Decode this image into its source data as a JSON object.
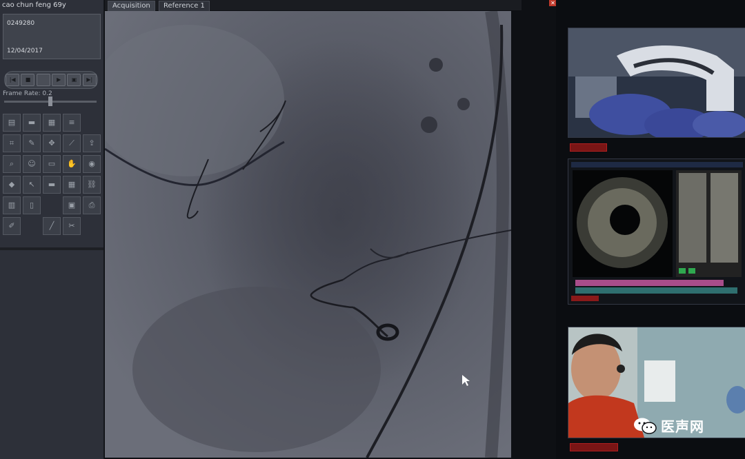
{
  "patient": {
    "name": "cao chun feng 69y",
    "id": "0249280",
    "date": "12/04/2017"
  },
  "playback": {
    "frame_rate_label": "Frame Rate: 0.2",
    "controls": [
      "first-frame-icon",
      "stop-icon",
      "pause-icon",
      "play-icon",
      "step-icon",
      "last-frame-icon"
    ]
  },
  "tabs": [
    {
      "label": "Acquisition",
      "active": true
    },
    {
      "label": "Reference 1",
      "active": false
    }
  ],
  "tools": [
    "archive-icon",
    "folder-icon",
    "grid-icon",
    "stack-icon",
    "blank",
    "crop-icon",
    "edit-icon",
    "move-icon",
    "measure-icon",
    "export-icon",
    "zoom-icon",
    "person-icon",
    "film-icon",
    "hand-icon",
    "camera-icon",
    "ruler-icon",
    "pointer-icon",
    "folder-icon",
    "grid-icon",
    "link-icon",
    "layers-icon",
    "book-icon",
    "blank",
    "window-icon",
    "print-icon",
    "brush-icon",
    "blank",
    "line-icon",
    "scissors-icon",
    "blank"
  ],
  "watermark": {
    "text": "医声网"
  },
  "colors": {
    "panel": "#2d3039",
    "accent_red": "#c0392b",
    "angio_bg": "#5a5d68"
  }
}
